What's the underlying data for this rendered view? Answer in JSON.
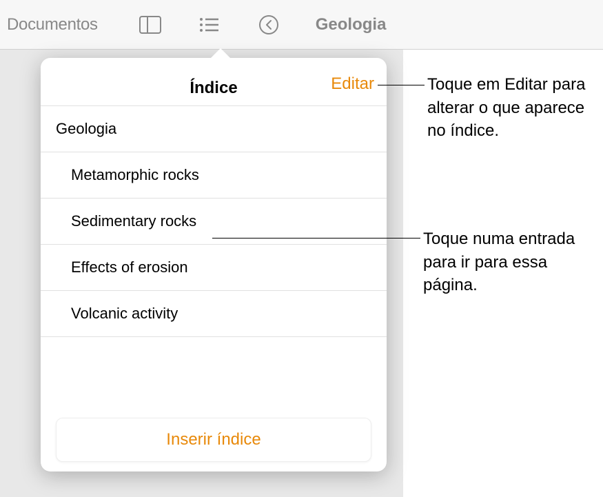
{
  "toolbar": {
    "back_label": "Documentos",
    "doc_title": "Geologia"
  },
  "popover": {
    "title": "Índice",
    "edit_label": "Editar",
    "insert_label": "Inserir índice",
    "items": [
      {
        "label": "Geologia",
        "level": 0
      },
      {
        "label": "Metamorphic rocks",
        "level": 1
      },
      {
        "label": "Sedimentary rocks",
        "level": 1
      },
      {
        "label": "Effects of erosion",
        "level": 1
      },
      {
        "label": "Volcanic activity",
        "level": 1
      }
    ]
  },
  "callouts": {
    "edit": "Toque em Editar para alterar o que aparece no índice.",
    "entry": "Toque numa entrada para ir para essa página."
  }
}
